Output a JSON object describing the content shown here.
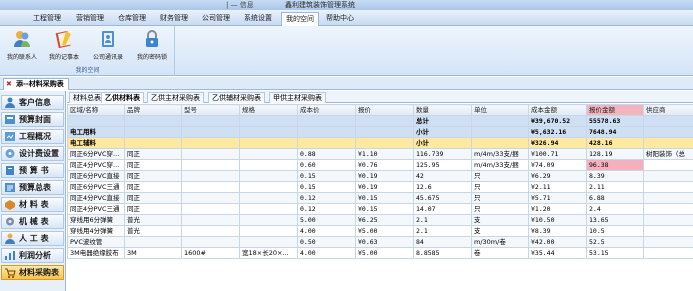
{
  "window": {
    "title_left": "| — 信息",
    "title": "鑫利建筑装饰管理系统"
  },
  "menu": [
    "工程管理",
    "营销管理",
    "仓库管理",
    "财务管理",
    "公司管理",
    "系统设置",
    "我的空间",
    "帮助中心"
  ],
  "ribbon": {
    "buttons": [
      {
        "label": "我的联系人",
        "icon": "contacts-icon"
      },
      {
        "label": "我的记事本",
        "icon": "notebook-icon"
      },
      {
        "label": "公司通讯录",
        "icon": "address-book-icon"
      },
      {
        "label": "我的密码锁",
        "icon": "lock-icon"
      }
    ],
    "group_label": "我的空间"
  },
  "doctab": {
    "label": "添--材料采购表"
  },
  "sidebar": [
    "客户信息",
    "预算封面",
    "工程概况",
    "设计费设置",
    "预 算 书",
    "预算总表",
    "材 料 表",
    "机 械 表",
    "人 工 表",
    "利润分析",
    "材料采购表"
  ],
  "subtabs": [
    "材料总表",
    "乙供材料表",
    "乙供主材采购表",
    "乙供辅材采购表",
    "甲供主材采购表"
  ],
  "table": {
    "columns": [
      "区域/名称",
      "品牌",
      "型号",
      "规格",
      "成本价",
      "报价",
      "数量",
      "单位",
      "成本金额",
      "报价金额",
      "供应商"
    ],
    "summary_rows": [
      {
        "area": "",
        "qty": "总计",
        "cost": "¥39,670.52",
        "quote": "55578.63"
      },
      {
        "area": "电工用料",
        "qty": "小计",
        "cost": "¥5,632.16",
        "quote": "7648.94"
      }
    ],
    "category_row": {
      "area": "电工辅料",
      "qty": "小计",
      "cost": "¥326.94",
      "quote": "428.16"
    },
    "rows": [
      {
        "name": "同正6分PVC穿...",
        "brand": "同正",
        "model": "",
        "spec": "",
        "cost_price": "0.88",
        "price": "¥1.10",
        "qty": "116.739",
        "unit": "m/4m/33支/捆",
        "cost_amt": "¥100.71",
        "quote_amt": "128.19",
        "supplier": "树阳装饰（总",
        "warn": false
      },
      {
        "name": "同正4分PVC穿...",
        "brand": "同正",
        "model": "",
        "spec": "",
        "cost_price": "0.60",
        "price": "¥0.76",
        "qty": "125.95",
        "unit": "m/4m/33支/捆",
        "cost_amt": "¥74.09",
        "quote_amt": "96.38",
        "supplier": "",
        "warn": true
      },
      {
        "name": "同正6分PVC直接",
        "brand": "同正",
        "model": "",
        "spec": "",
        "cost_price": "0.15",
        "price": "¥0.19",
        "qty": "42",
        "unit": "只",
        "cost_amt": "¥6.29",
        "quote_amt": "8.39",
        "supplier": "",
        "warn": false
      },
      {
        "name": "同正6分PVC三通",
        "brand": "同正",
        "model": "",
        "spec": "",
        "cost_price": "0.15",
        "price": "¥0.19",
        "qty": "12.6",
        "unit": "只",
        "cost_amt": "¥2.11",
        "quote_amt": "2.11",
        "supplier": "",
        "warn": false
      },
      {
        "name": "同正4分PVC直接",
        "brand": "同正",
        "model": "",
        "spec": "",
        "cost_price": "0.12",
        "price": "¥0.15",
        "qty": "45.675",
        "unit": "只",
        "cost_amt": "¥5.71",
        "quote_amt": "6.88",
        "supplier": "",
        "warn": false
      },
      {
        "name": "同正4分PVC三通",
        "brand": "同正",
        "model": "",
        "spec": "",
        "cost_price": "0.12",
        "price": "¥0.15",
        "qty": "14.07",
        "unit": "只",
        "cost_amt": "¥1.20",
        "quote_amt": "2.4",
        "supplier": "",
        "warn": false
      },
      {
        "name": "穿线用6分弹簧",
        "brand": "普光",
        "model": "",
        "spec": "",
        "cost_price": "5.00",
        "price": "¥6.25",
        "qty": "2.1",
        "unit": "支",
        "cost_amt": "¥10.50",
        "quote_amt": "13.65",
        "supplier": "",
        "warn": false
      },
      {
        "name": "穿线用4分弹簧",
        "brand": "普光",
        "model": "",
        "spec": "",
        "cost_price": "4.00",
        "price": "¥5.00",
        "qty": "2.1",
        "unit": "支",
        "cost_amt": "¥8.39",
        "quote_amt": "10.5",
        "supplier": "",
        "warn": false
      },
      {
        "name": "PVC波纹管",
        "brand": "",
        "model": "",
        "spec": "",
        "cost_price": "0.50",
        "price": "¥0.63",
        "qty": "84",
        "unit": "m/30m/卷",
        "cost_amt": "¥42.00",
        "quote_amt": "52.5",
        "supplier": "",
        "warn": false
      },
      {
        "name": "3M电器绝缘胶布",
        "brand": "3M",
        "model": "1600#",
        "spec": "宽18×长20×...",
        "cost_price": "4.00",
        "price": "¥5.00",
        "qty": "8.8585",
        "unit": "卷",
        "cost_amt": "¥35.44",
        "quote_amt": "53.15",
        "supplier": "",
        "warn": false
      }
    ]
  },
  "colors": {
    "accent": "#9cb7dc",
    "category": "#ffe9a0",
    "warn": "#f6b0bd"
  }
}
